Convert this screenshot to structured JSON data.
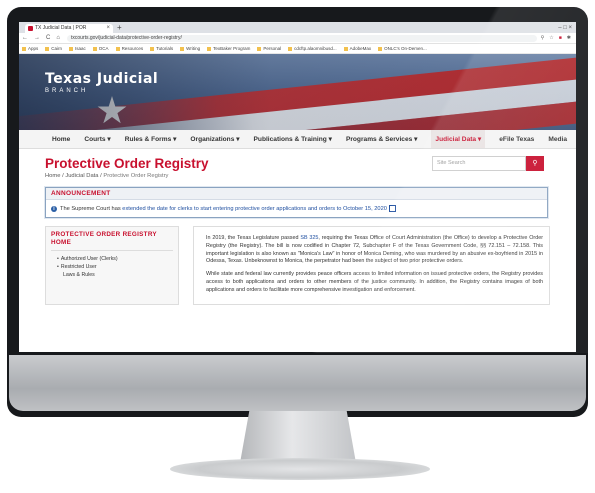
{
  "browser": {
    "tab_title": "TX Judicial Data | POR",
    "tab_close": "×",
    "new_tab": "+",
    "window_controls": "–  □  ×",
    "back": "←",
    "forward": "→",
    "reload": "C",
    "home": "⌂",
    "url": "txcourts.gov/judicial-data/protective-order-registry/",
    "bookmarks": [
      "Apps",
      "Cairn",
      "Isaac",
      "OCA",
      "Resources",
      "Tutorials",
      "Writing",
      "TexBaker Program",
      "Personal",
      "cdcftp.alaomnibusd...",
      "AdobeMax",
      "ONLC's On-Demen..."
    ]
  },
  "site": {
    "brand_title": "Texas Judicial",
    "brand_subtitle": "BRANCH"
  },
  "nav": {
    "items": [
      "Home",
      "Courts ▾",
      "Rules & Forms ▾",
      "Organizations ▾",
      "Publications & Training ▾",
      "Programs & Services ▾",
      "Judicial Data ▾",
      "eFile Texas",
      "Media"
    ],
    "active_index": 6
  },
  "page": {
    "title": "Protective Order Registry",
    "search_placeholder": "Site Search",
    "search_button_icon": "search-icon",
    "breadcrumb": {
      "home": "Home",
      "sep1": " / ",
      "section": "Judicial Data",
      "sep2": " / ",
      "current": "Protective Order Registry"
    }
  },
  "announcement": {
    "heading": "ANNOUNCEMENT",
    "text_before": "The Supreme Court has ",
    "link_text": "extended the date for clerks to start entering protective order applications and orders to October 15, 2020",
    "info_icon": "info-icon",
    "external_icon": "external-link-icon"
  },
  "sidebar": {
    "heading": "PROTECTIVE ORDER REGISTRY HOME",
    "items": [
      "Authorized User (Clerks)",
      "Restricted User",
      "Laws & Rules"
    ]
  },
  "main": {
    "p1_a": "In 2019, the Texas Legislature passed ",
    "p1_link": "SB 325",
    "p1_b": ", requiring the Texas Office of Court Administration (the Office) to develop a Protective Order Registry (the Registry). The bill is now codified in Chapter 72, Subchapter F of the Texas Government Code, §§ 72.151 – 72.158. This important legislation is also known as \"Monica's Law\" in honor of Monica Deming, who was murdered by an abusive ex-boyfriend in 2015 in Odessa, Texas. Unbeknownst to Monica, the perpetrator had been the subject of two prior protective orders.",
    "p2": "While state and federal law currently provides peace officers access to limited information on issued protective orders, the Registry provides access to both applications and orders to other members of the justice community. In addition, the Registry contains images of both applications and orders to facilitate more comprehensive investigation and enforcement."
  },
  "colors": {
    "accent": "#c8102e",
    "link": "#1f4fa0"
  }
}
